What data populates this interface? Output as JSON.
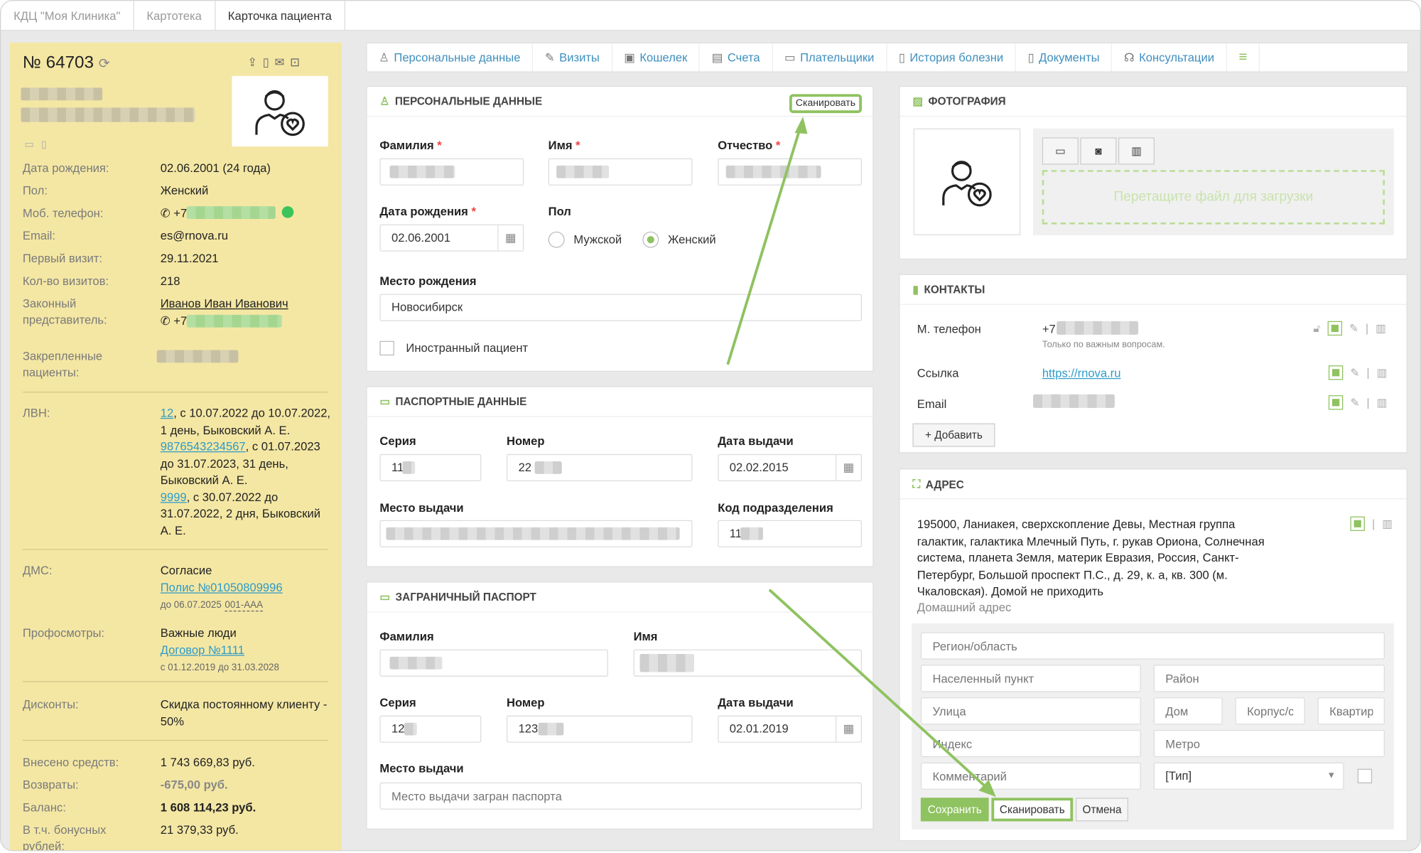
{
  "breadcrumbs": [
    "КДЦ \"Моя Клиника\"",
    "Картотека",
    "Карточка пациента"
  ],
  "patient": {
    "number": "№ 64703",
    "info": [
      {
        "label": "Дата рождения:",
        "value": "02.06.2001 (24 года)"
      },
      {
        "label": "Пол:",
        "value": "Женский"
      },
      {
        "label": "Моб. телефон:",
        "value": "+7"
      },
      {
        "label": "Email:",
        "value": "es@rnova.ru"
      },
      {
        "label": "Первый визит:",
        "value": "29.11.2021"
      },
      {
        "label": "Кол-во визитов:",
        "value": "218"
      }
    ],
    "legal_rep_label": "Законный представитель:",
    "legal_rep_name": "Иванов Иван Иванович",
    "legal_rep_phone": "+7",
    "attached_label": "Закрепленные пациенты:",
    "lvn_label": "ЛВН:",
    "lvn": [
      {
        "id": "12",
        "text": ", с 10.07.2022 до 10.07.2022, 1 день, Быковский А. Е."
      },
      {
        "id": "9876543234567",
        "text": ", с 01.07.2023 до 31.07.2023, 31 день, Быковский А. Е."
      },
      {
        "id": "9999",
        "text": ", с 30.07.2022 до 31.07.2022, 2 дня, Быковский А. Е."
      }
    ],
    "dms_label": "ДМС:",
    "dms_status": "Согласие",
    "dms_policy": "Полис №01050809996",
    "dms_until": "до 06.07.2025",
    "dms_code": "001-AAA",
    "prof_label": "Профосмотры:",
    "prof_name": "Важные люди",
    "prof_contract": "Договор №1111",
    "prof_dates": "с 01.12.2019 до 31.03.2028",
    "disc_label": "Дисконты:",
    "disc_value": "Скидка постоянному клиенту - 50%",
    "finance": [
      {
        "label": "Внесено средств:",
        "value": "1 743 669,83 руб."
      },
      {
        "label": "Возвраты:",
        "value": "-675,00 руб."
      },
      {
        "label": "Баланс:",
        "value": "1 608 114,23 руб."
      },
      {
        "label": "В т.ч. бонусных рублей:",
        "value": "21 379,33 руб."
      }
    ]
  },
  "tabs": [
    {
      "label": "Персональные данные",
      "icon": "person-icon"
    },
    {
      "label": "Визиты",
      "icon": "edit-icon"
    },
    {
      "label": "Кошелек",
      "icon": "wallet-icon"
    },
    {
      "label": "Счета",
      "icon": "invoice-icon"
    },
    {
      "label": "Плательщики",
      "icon": "card-icon"
    },
    {
      "label": "История болезни",
      "icon": "clipboard-icon"
    },
    {
      "label": "Документы",
      "icon": "document-icon"
    },
    {
      "label": "Консультации",
      "icon": "headset-icon"
    }
  ],
  "personal": {
    "title": "ПЕРСОНАЛЬНЫЕ ДАННЫЕ",
    "scan": "Сканировать",
    "surname_label": "Фамилия",
    "name_label": "Имя",
    "patronymic_label": "Отчество",
    "birth_label": "Дата рождения",
    "birth_value": "02.06.2001",
    "gender_label": "Пол",
    "male": "Мужской",
    "female": "Женский",
    "birthplace_label": "Место рождения",
    "birthplace_value": "Новосибирск",
    "foreign": "Иностранный пациент"
  },
  "passport": {
    "title": "ПАСПОРТНЫЕ ДАННЫЕ",
    "series_label": "Серия",
    "series_value": "11",
    "number_label": "Номер",
    "number_value": "22",
    "date_label": "Дата выдачи",
    "date_value": "02.02.2015",
    "place_label": "Место выдачи",
    "code_label": "Код подразделения",
    "code_value": "11"
  },
  "foreign": {
    "title": "ЗАГРАНИЧНЫЙ ПАСПОРТ",
    "surname_label": "Фамилия",
    "name_label": "Имя",
    "series_label": "Серия",
    "series_value": "12",
    "number_label": "Номер",
    "number_value": "123",
    "date_label": "Дата выдачи",
    "date_value": "02.01.2019",
    "place_label": "Место выдачи",
    "place_placeholder": "Место выдачи загран паспорта"
  },
  "photo": {
    "title": "ФОТОГРАФИЯ",
    "drop": "Перетащите файл для загрузки"
  },
  "contacts": {
    "title": "КОНТАКТЫ",
    "phone_label": "М. телефон",
    "phone_value": "+7",
    "phone_note": "Только по важным вопросам.",
    "link_label": "Ссылка",
    "link_value": "https://rnova.ru",
    "email_label": "Email",
    "add": "Добавить"
  },
  "address": {
    "title": "АДРЕС",
    "text": "195000, Ланиакея, сверхскопление Девы, Местная группа галактик, галактика Млечный Путь, г. рукав Ориона, Солнечная система, планета Земля, материк Евразия, Россия, Санкт-Петербург, Большой проспект П.С., д. 29, к. а, кв. 300 (м. Чкаловская). Домой не приходить",
    "type": "Домашний адрес",
    "ph_region": "Регион/область",
    "ph_city": "Населенный пункт",
    "ph_district": "Район",
    "ph_street": "Улица",
    "ph_house": "Дом",
    "ph_building": "Корпус/с",
    "ph_apt": "Квартира",
    "ph_index": "Индекс",
    "ph_metro": "Метро",
    "ph_comment": "Комментарий",
    "type_select": "[Тип]",
    "save": "Сохранить",
    "scan": "Сканировать",
    "cancel": "Отмена"
  }
}
